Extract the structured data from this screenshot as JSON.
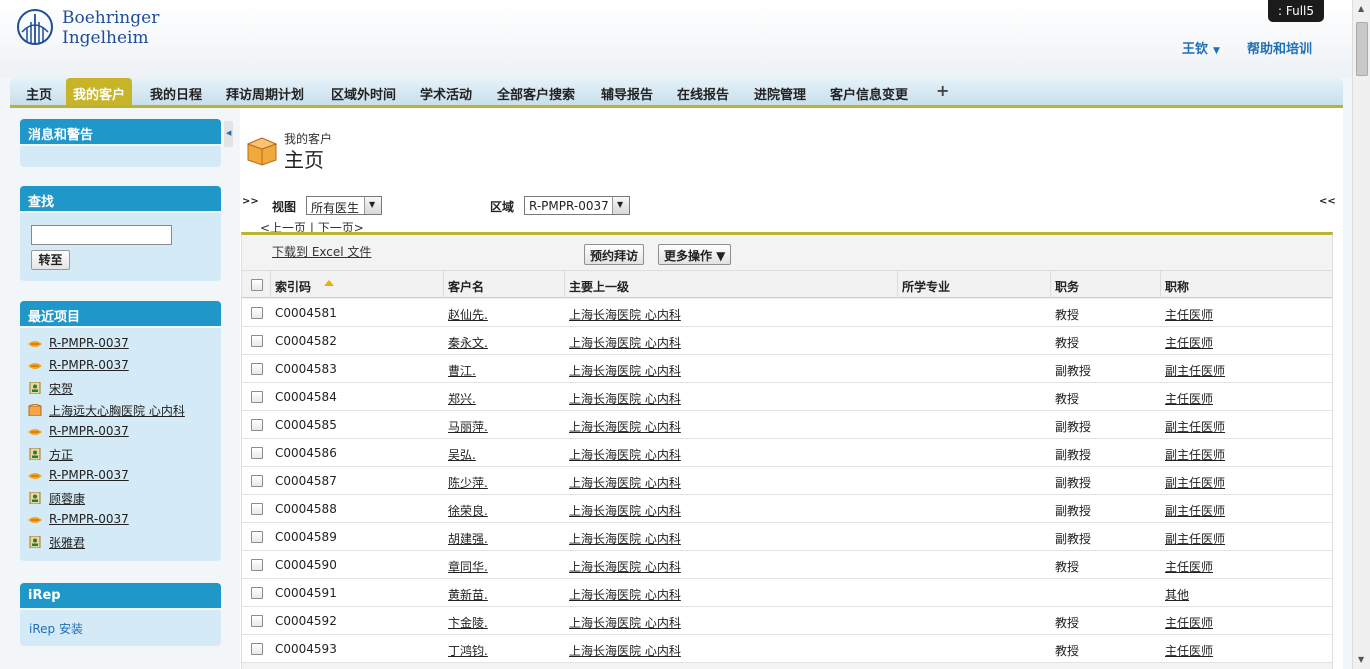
{
  "brand": {
    "line1": "Boehringer",
    "line2": "Ingelheim"
  },
  "badge": ":  Full5",
  "header": {
    "user": "王钦",
    "user_caret": "▼",
    "help": "帮助和培训"
  },
  "tabs": [
    "主页",
    "我的客户",
    "我的日程",
    "拜访周期计划",
    "区域外时间",
    "学术活动",
    "全部客户搜索",
    "辅导报告",
    "在线报告",
    "进院管理",
    "客户信息变更",
    "+"
  ],
  "sidebar": {
    "messages_title": "消息和警告",
    "search_title": "查找",
    "search_value": "",
    "go_label": "转至",
    "recent_title": "最近项目",
    "recent_items": [
      {
        "icon": "region-icon",
        "label": "R-PMPR-0037"
      },
      {
        "icon": "region-icon",
        "label": "R-PMPR-0037"
      },
      {
        "icon": "contact-card-icon",
        "label": "宋贺"
      },
      {
        "icon": "account-box-icon",
        "label": "上海远大心胸医院 心内科"
      },
      {
        "icon": "region-icon",
        "label": "R-PMPR-0037"
      },
      {
        "icon": "contact-card-icon",
        "label": "方正"
      },
      {
        "icon": "region-icon",
        "label": "R-PMPR-0037"
      },
      {
        "icon": "contact-card-icon",
        "label": "顾蓉康"
      },
      {
        "icon": "region-icon",
        "label": "R-PMPR-0037"
      },
      {
        "icon": "contact-card-icon",
        "label": "张雅君"
      }
    ],
    "irep_title": "iRep",
    "irep_link": "iRep 安装"
  },
  "main": {
    "page_type": "我的客户",
    "page_title": "主页",
    "expand_left": ">>",
    "expand_right": "<<",
    "view_label": "视图",
    "view_value": "所有医生",
    "region_label": "区域",
    "region_value": "R-PMPR-0037",
    "pager": {
      "prev": "<上一页",
      "sep": " | ",
      "next": "下一页>"
    },
    "export_label": "下载到 Excel 文件",
    "book_button": "预约拜访",
    "more_button": "更多操作 ▼",
    "columns": [
      "索引码",
      "客户名",
      "主要上一级",
      "所学专业",
      "职务",
      "职称"
    ],
    "rows": [
      {
        "code": "C0004581",
        "name": "赵仙先.",
        "parent": "上海长海医院 心内科",
        "major": "",
        "position": "教授",
        "title": "主任医师"
      },
      {
        "code": "C0004582",
        "name": "秦永文.",
        "parent": "上海长海医院 心内科",
        "major": "",
        "position": "教授",
        "title": "主任医师"
      },
      {
        "code": "C0004583",
        "name": "曹江.",
        "parent": "上海长海医院 心内科",
        "major": "",
        "position": "副教授",
        "title": "副主任医师"
      },
      {
        "code": "C0004584",
        "name": "郑兴.",
        "parent": "上海长海医院 心内科",
        "major": "",
        "position": "教授",
        "title": "主任医师"
      },
      {
        "code": "C0004585",
        "name": "马丽萍.",
        "parent": "上海长海医院 心内科",
        "major": "",
        "position": "副教授",
        "title": "副主任医师"
      },
      {
        "code": "C0004586",
        "name": "吴弘.",
        "parent": "上海长海医院 心内科",
        "major": "",
        "position": "副教授",
        "title": "副主任医师"
      },
      {
        "code": "C0004587",
        "name": "陈少萍.",
        "parent": "上海长海医院 心内科",
        "major": "",
        "position": "副教授",
        "title": "副主任医师"
      },
      {
        "code": "C0004588",
        "name": "徐荣良.",
        "parent": "上海长海医院 心内科",
        "major": "",
        "position": "副教授",
        "title": "副主任医师"
      },
      {
        "code": "C0004589",
        "name": "胡建强.",
        "parent": "上海长海医院 心内科",
        "major": "",
        "position": "副教授",
        "title": "副主任医师"
      },
      {
        "code": "C0004590",
        "name": "章同华.",
        "parent": "上海长海医院 心内科",
        "major": "",
        "position": "教授",
        "title": "主任医师"
      },
      {
        "code": "C0004591",
        "name": "黄新苗.",
        "parent": "上海长海医院 心内科",
        "major": "",
        "position": "",
        "title": "其他"
      },
      {
        "code": "C0004592",
        "name": "卞金陵.",
        "parent": "上海长海医院 心内科",
        "major": "",
        "position": "教授",
        "title": "主任医师"
      },
      {
        "code": "C0004593",
        "name": "丁鸿钧.",
        "parent": "上海长海医院 心内科",
        "major": "",
        "position": "教授",
        "title": "主任医师"
      }
    ]
  }
}
